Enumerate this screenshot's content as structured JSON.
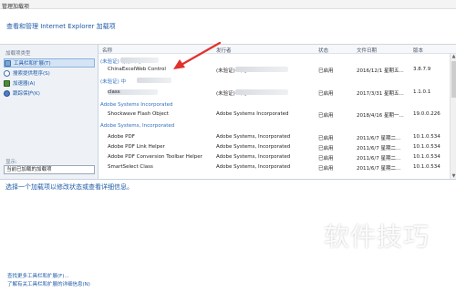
{
  "window": {
    "title": "管理加载项"
  },
  "header": {
    "title": "查看和管理 Internet Explorer 加载项"
  },
  "sidebar": {
    "section_label": "加载项类型",
    "items": [
      {
        "label": "工具栏和扩展(T)",
        "icon": "toolbar-icon",
        "selected": true
      },
      {
        "label": "搜索提供程序(S)",
        "icon": "search-icon",
        "selected": false
      },
      {
        "label": "加速器(A)",
        "icon": "accelerator-icon",
        "selected": false
      },
      {
        "label": "跟踪保护(K)",
        "icon": "tracking-protection-icon",
        "selected": false
      }
    ],
    "show_label": "显示:",
    "show_value": "当前已加载的加载项"
  },
  "list": {
    "columns": [
      "名称",
      "发行者",
      "状态",
      "文件日期",
      "版本"
    ],
    "groups": [
      {
        "label": "(未验证)            有限公司",
        "rows": [
          {
            "name": "ChinaExcelWeb Control",
            "publisher": "(未验证)            公司",
            "status": "已启用",
            "date": "2016/12/1 星期五...",
            "version": "3.8.7.9"
          }
        ]
      },
      {
        "label": "(未验证)  中",
        "rows": [
          {
            "name": "          class",
            "publisher": "(未验证)            公司",
            "status": "已启用",
            "date": "2017/3/31 星期五...",
            "version": "1.1.0.1"
          }
        ]
      },
      {
        "label": "Adobe Systems Incorporated",
        "rows": [
          {
            "name": "Shockwave Flash Object",
            "publisher": "Adobe Systems Incorporated",
            "status": "已启用",
            "date": "2018/4/16 星期一...",
            "version": "19.0.0.226"
          }
        ]
      },
      {
        "label": "Adobe Systems, Incorporated",
        "rows": [
          {
            "name": "Adobe PDF",
            "publisher": "Adobe Systems, Incorporated",
            "status": "已启用",
            "date": "2011/6/7 星期二...",
            "version": "10.1.0.534"
          },
          {
            "name": "Adobe PDF Link Helper",
            "publisher": "Adobe Systems, Incorporated",
            "status": "已启用",
            "date": "2011/6/7 星期二...",
            "version": "10.1.0.534"
          },
          {
            "name": "Adobe PDF Conversion Toolbar Helper",
            "publisher": "Adobe Systems, Incorporated",
            "status": "已启用",
            "date": "2011/6/7 星期二...",
            "version": "10.1.0.534"
          },
          {
            "name": "SmartSelect Class",
            "publisher": "Adobe Systems, Incorporated",
            "status": "已启用",
            "date": "2011/6/7 星期二...",
            "version": "10.1.0.534"
          }
        ]
      }
    ]
  },
  "status_text": "选择一个加载项以修改状态或查看详细信息。",
  "footer": {
    "link1": "查找更多工具栏和扩展(F)...",
    "link2": "了解有关工具栏和扩展的详细信息(N)"
  },
  "watermark": "软件技巧",
  "colors": {
    "link": "#1e5aa8",
    "group": "#2f6fbf",
    "arrow": "#e0312b",
    "sidebar_bg": "#eef2f7"
  }
}
